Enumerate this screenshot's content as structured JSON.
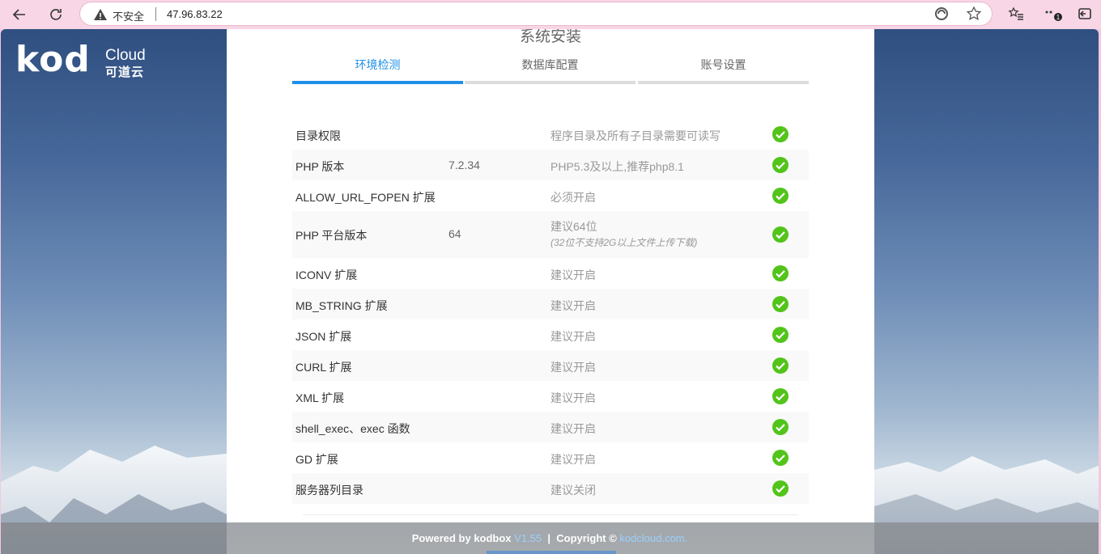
{
  "browser": {
    "insecure_label": "不安全",
    "url": "47.96.83.22",
    "notification_badge": "1"
  },
  "logo": {
    "brand": "kod",
    "cloud": "Cloud",
    "chinese": "可道云"
  },
  "installer": {
    "title": "系统安装",
    "steps": [
      "环境检测",
      "数据库配置",
      "账号设置"
    ],
    "active_step": 0
  },
  "checks": [
    {
      "name": "目录权限",
      "value": "",
      "requirement": "程序目录及所有子目录需要可读写",
      "status": "ok"
    },
    {
      "name": "PHP 版本",
      "value": "7.2.34",
      "requirement": "PHP5.3及以上,推荐php8.1",
      "status": "ok"
    },
    {
      "name": "ALLOW_URL_FOPEN 扩展",
      "value": "",
      "requirement": "必须开启",
      "status": "ok"
    },
    {
      "name": "PHP 平台版本",
      "value": "64",
      "requirement": "建议64位",
      "requirement_note": "(32位不支持2G以上文件上传下载)",
      "status": "ok"
    },
    {
      "name": "ICONV 扩展",
      "value": "",
      "requirement": "建议开启",
      "status": "ok"
    },
    {
      "name": "MB_STRING 扩展",
      "value": "",
      "requirement": "建议开启",
      "status": "ok"
    },
    {
      "name": "JSON 扩展",
      "value": "",
      "requirement": "建议开启",
      "status": "ok"
    },
    {
      "name": "CURL 扩展",
      "value": "",
      "requirement": "建议开启",
      "status": "ok"
    },
    {
      "name": "XML 扩展",
      "value": "",
      "requirement": "建议开启",
      "status": "ok"
    },
    {
      "name": "shell_exec、exec 函数",
      "value": "",
      "requirement": "建议开启",
      "status": "ok"
    },
    {
      "name": "GD 扩展",
      "value": "",
      "requirement": "建议开启",
      "status": "ok"
    },
    {
      "name": "服务器列目录",
      "value": "",
      "requirement": "建议关闭",
      "status": "ok"
    }
  ],
  "footer": {
    "powered": "Powered by kodbox ",
    "version": "V1.55",
    "sep": "  |  ",
    "copyright": "Copyright © ",
    "site": "kodcloud.com",
    "dot": "."
  },
  "colors": {
    "accent": "#1e90e8",
    "ok": "#52c41a"
  }
}
